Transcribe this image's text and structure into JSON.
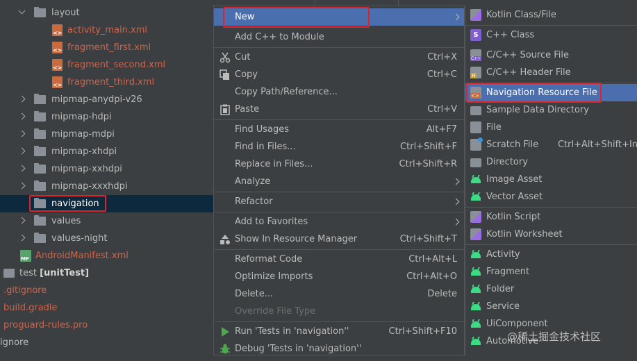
{
  "tree": {
    "items": [
      {
        "label": "layout"
      },
      {
        "label": "activity_main.xml"
      },
      {
        "label": "fragment_first.xml"
      },
      {
        "label": "fragment_second.xml"
      },
      {
        "label": "fragment_third.xml"
      },
      {
        "label": "mipmap-anydpi-v26"
      },
      {
        "label": "mipmap-hdpi"
      },
      {
        "label": "mipmap-mdpi"
      },
      {
        "label": "mipmap-xhdpi"
      },
      {
        "label": "mipmap-xxhdpi"
      },
      {
        "label": "mipmap-xxxhdpi"
      },
      {
        "label": "navigation"
      },
      {
        "label": "values"
      },
      {
        "label": "values-night"
      },
      {
        "label": "AndroidManifest.xml"
      },
      {
        "label": "test",
        "badge": "[unitTest]"
      },
      {
        "label": ".gitignore"
      },
      {
        "label": "build.gradle"
      },
      {
        "label": "proguard-rules.pro"
      },
      {
        "label": "ignore"
      }
    ]
  },
  "menu": {
    "items": [
      {
        "label": "New",
        "shortcut": ""
      },
      {
        "label": "Add C++ to Module",
        "shortcut": ""
      },
      {
        "label": "Cut",
        "shortcut": "Ctrl+X"
      },
      {
        "label": "Copy",
        "shortcut": "Ctrl+C"
      },
      {
        "label": "Copy Path/Reference...",
        "shortcut": ""
      },
      {
        "label": "Paste",
        "shortcut": "Ctrl+V"
      },
      {
        "label": "Find Usages",
        "shortcut": "Alt+F7"
      },
      {
        "label": "Find in Files...",
        "shortcut": "Ctrl+Shift+F"
      },
      {
        "label": "Replace in Files...",
        "shortcut": "Ctrl+Shift+R"
      },
      {
        "label": "Analyze",
        "shortcut": ""
      },
      {
        "label": "Refactor",
        "shortcut": ""
      },
      {
        "label": "Add to Favorites",
        "shortcut": ""
      },
      {
        "label": "Show In Resource Manager",
        "shortcut": "Ctrl+Shift+T"
      },
      {
        "label": "Reformat Code",
        "shortcut": "Ctrl+Alt+L"
      },
      {
        "label": "Optimize Imports",
        "shortcut": "Ctrl+Alt+O"
      },
      {
        "label": "Delete...",
        "shortcut": "Delete"
      },
      {
        "label": "Override File Type",
        "shortcut": ""
      },
      {
        "label": "Run 'Tests in 'navigation''",
        "shortcut": "Ctrl+Shift+F10"
      },
      {
        "label": "Debug 'Tests in 'navigation''",
        "shortcut": ""
      }
    ]
  },
  "submenu": {
    "items": [
      {
        "label": "Kotlin Class/File",
        "shortcut": ""
      },
      {
        "label": "C++ Class",
        "shortcut": ""
      },
      {
        "label": "C/C++ Source File",
        "shortcut": ""
      },
      {
        "label": "C/C++ Header File",
        "shortcut": ""
      },
      {
        "label": "Navigation Resource File",
        "shortcut": ""
      },
      {
        "label": "Sample Data Directory",
        "shortcut": ""
      },
      {
        "label": "File",
        "shortcut": ""
      },
      {
        "label": "Scratch File",
        "shortcut": "Ctrl+Alt+Shift+Ins"
      },
      {
        "label": "Directory",
        "shortcut": ""
      },
      {
        "label": "Image Asset",
        "shortcut": ""
      },
      {
        "label": "Vector Asset",
        "shortcut": ""
      },
      {
        "label": "Kotlin Script",
        "shortcut": ""
      },
      {
        "label": "Kotlin Worksheet",
        "shortcut": ""
      },
      {
        "label": "Activity",
        "shortcut": ""
      },
      {
        "label": "Fragment",
        "shortcut": ""
      },
      {
        "label": "Folder",
        "shortcut": ""
      },
      {
        "label": "Service",
        "shortcut": ""
      },
      {
        "label": "UiComponent",
        "shortcut": ""
      },
      {
        "label": "Automotive",
        "shortcut": ""
      }
    ]
  },
  "watermark": "@稀土掘金技术社区",
  "colors": {
    "background": "#3c3f41",
    "selection": "#4b6eaf",
    "tree_selection": "#0d293e",
    "file_red": "#d0634a",
    "highlight_box": "#e0222a"
  }
}
